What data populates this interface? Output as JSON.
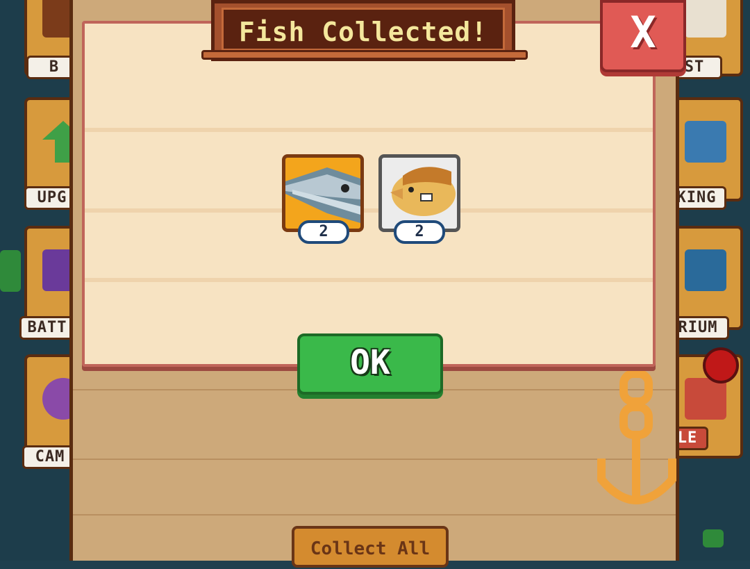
{
  "dialog": {
    "title": "Fish Collected!",
    "close_label": "X",
    "ok_label": "OK"
  },
  "rewards": [
    {
      "name": "swordfish",
      "count": "2",
      "rarity_color": "#f3a51c"
    },
    {
      "name": "bluegill",
      "count": "2",
      "rarity_color": "#ececec"
    }
  ],
  "left_menu": [
    {
      "label": "B",
      "icon": "chest-icon"
    },
    {
      "label": "UPG",
      "icon": "upgrade-arrow-icon"
    },
    {
      "label": "BATT",
      "icon": "battle-icon"
    },
    {
      "label": "CAM",
      "icon": "camera-icon"
    }
  ],
  "right_menu": [
    {
      "label": "ST",
      "icon": "quest-feather-icon"
    },
    {
      "label": "KING",
      "icon": "cooking-icon"
    },
    {
      "label": "RIUM",
      "icon": "aquarium-icon"
    },
    {
      "label": "LE",
      "icon": "sale-icon"
    }
  ],
  "bottom": {
    "collect_all_label": "Collect All"
  },
  "colors": {
    "ok_green": "#3ab94a",
    "close_red": "#e05a55",
    "title_text": "#f4e79c",
    "notification_red": "#c01818"
  }
}
